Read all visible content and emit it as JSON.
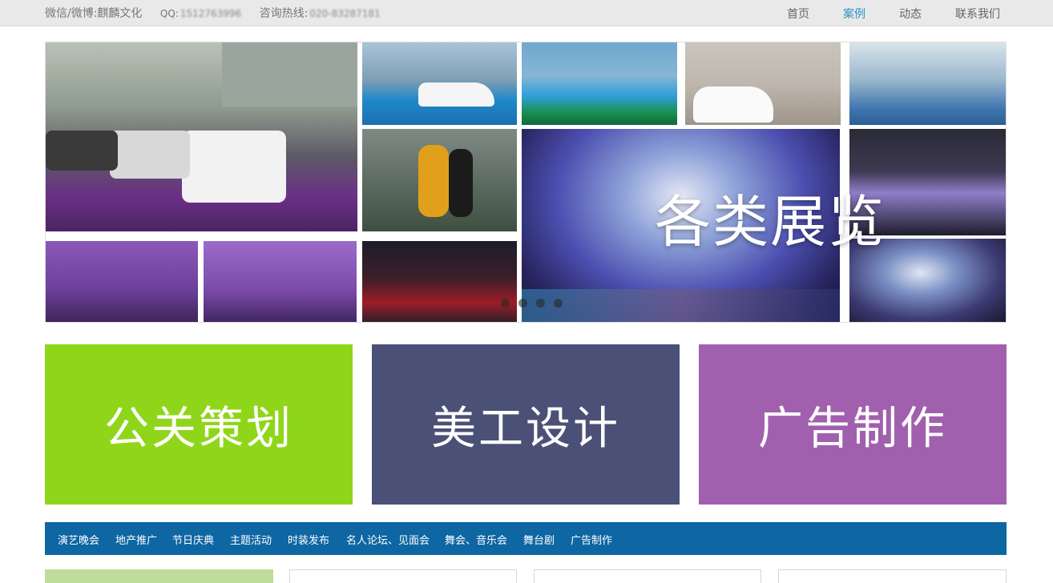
{
  "topbar": {
    "wechat_weibo": "微信/微博:麒麟文化",
    "qq_label": "QQ:",
    "qq_value": "1512763996",
    "hotline_label": "咨询热线:",
    "hotline_value": "020-83287181"
  },
  "nav": {
    "items": [
      {
        "label": "首页",
        "active": false
      },
      {
        "label": "案例",
        "active": true
      },
      {
        "label": "动态",
        "active": false
      },
      {
        "label": "联系我们",
        "active": false
      }
    ]
  },
  "banner": {
    "caption": "各类展览",
    "dot_count": 4
  },
  "tiles": [
    {
      "label": "公关策划",
      "color": "#8fd61a"
    },
    {
      "label": "美工设计",
      "color": "#4b5076"
    },
    {
      "label": "广告制作",
      "color": "#a160ae"
    }
  ],
  "categories": [
    "演艺晚会",
    "地产推广",
    "节日庆典",
    "主题活动",
    "时装发布",
    "名人论坛、见面会",
    "舞会、音乐会",
    "舞台剧",
    "广告制作"
  ],
  "colors": {
    "accent_link": "#2a93c9",
    "category_bar": "#0e66a3",
    "bottom_first_box": "#bedd9a"
  }
}
